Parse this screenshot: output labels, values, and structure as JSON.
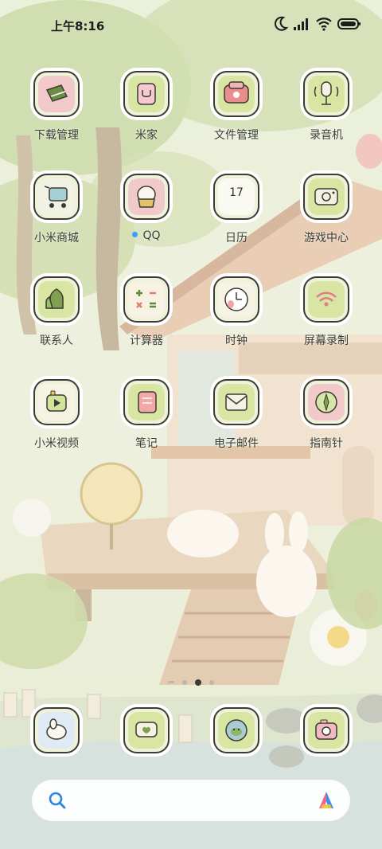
{
  "status_bar": {
    "time": "上午8:16",
    "icons": [
      "moon-icon",
      "signal-icon",
      "wifi-icon",
      "battery-icon"
    ]
  },
  "apps": [
    {
      "label": "下载管理",
      "icon": "download-icon"
    },
    {
      "label": "米家",
      "icon": "mijia-icon"
    },
    {
      "label": "文件管理",
      "icon": "folder-icon"
    },
    {
      "label": "录音机",
      "icon": "microphone-icon"
    },
    {
      "label": "小米商城",
      "icon": "shopping-cart-icon"
    },
    {
      "label": "QQ",
      "icon": "qq-icon",
      "notification_dot": true
    },
    {
      "label": "日历",
      "icon": "calendar-icon",
      "icon_text": "17"
    },
    {
      "label": "游戏中心",
      "icon": "game-icon"
    },
    {
      "label": "联系人",
      "icon": "contacts-icon"
    },
    {
      "label": "计算器",
      "icon": "calculator-icon"
    },
    {
      "label": "时钟",
      "icon": "clock-icon"
    },
    {
      "label": "屏幕录制",
      "icon": "screen-record-icon"
    },
    {
      "label": "小米视频",
      "icon": "video-icon"
    },
    {
      "label": "笔记",
      "icon": "notes-icon"
    },
    {
      "label": "电子邮件",
      "icon": "email-icon"
    },
    {
      "label": "指南针",
      "icon": "compass-icon"
    }
  ],
  "dock": [
    {
      "icon": "phone-icon"
    },
    {
      "icon": "messages-icon"
    },
    {
      "icon": "browser-icon"
    },
    {
      "icon": "camera-icon"
    }
  ],
  "page_indicator": {
    "pages": 4,
    "active": 2
  },
  "colors": {
    "tile_green": "#d9e6a3",
    "tile_pink": "#f1c9c9",
    "notification_dot": "#3b9dff"
  }
}
